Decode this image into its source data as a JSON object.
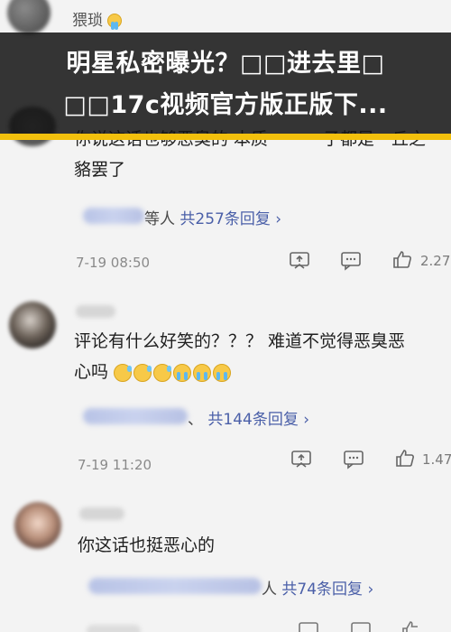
{
  "title_banner": {
    "line1": "明星私密曝光？□□进去里□",
    "line2": "□□17c视频官方版正版下..."
  },
  "comments": [
    {
      "username": "猥琐",
      "body_lines": [
        "你说这话也够恶臭的 本质",
        "子都是一丘之",
        "貉罢了"
      ],
      "reply_suffix": "等人",
      "reply_count": "共257条回复 ›",
      "timestamp": "7-19 08:50",
      "likes": "2.27"
    },
    {
      "body_lines": [
        "评论有什么好笑的？？？ 难道不觉得恶臭恶",
        "心吗"
      ],
      "reply_suffix": "、",
      "reply_count": "共144条回复 ›",
      "timestamp": "7-19 11:20",
      "likes": "1.47"
    },
    {
      "body_lines": [
        "你这话也挺恶心的"
      ],
      "reply_suffix": "人",
      "reply_count": "共74条回复 ›"
    }
  ],
  "colors": {
    "banner_bg": "#141414",
    "banner_text": "#ffffff",
    "accent_bar": "#f2c00d",
    "reply_link": "#4a5fa8"
  },
  "icons": [
    "comment-icon",
    "share-icon",
    "thumbs-up-icon",
    "emoji-sweat-smile",
    "emoji-crying"
  ]
}
